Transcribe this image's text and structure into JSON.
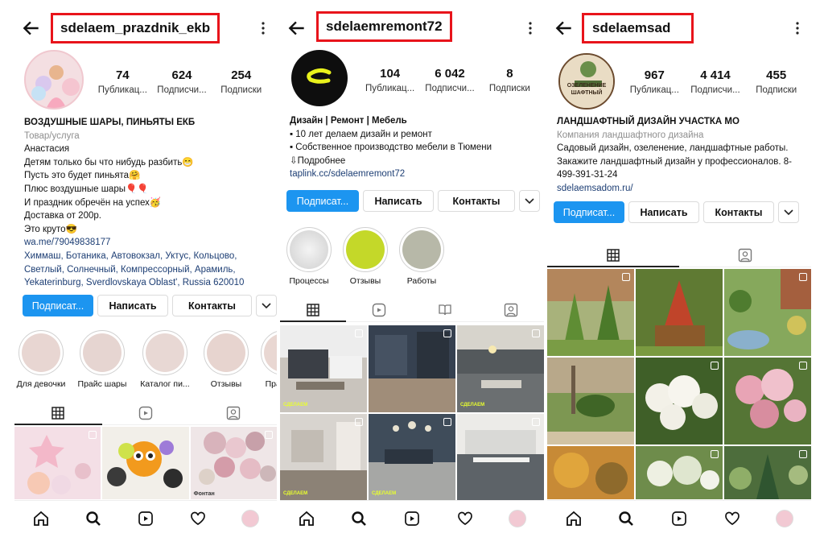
{
  "profiles": [
    {
      "username": "sdelaem_prazdnik_ekb",
      "stats": [
        {
          "num": "74",
          "label": "Публикац..."
        },
        {
          "num": "624",
          "label": "Подписчи..."
        },
        {
          "num": "254",
          "label": "Подписки"
        }
      ],
      "bio": {
        "name": "ВОЗДУШНЫЕ ШАРЫ, ПИНЬЯТЫ ЕКБ",
        "category": "Товар/услуга",
        "lines": [
          "Анастасия",
          "Детям только бы что нибудь разбить😁",
          "Пусть это будет пиньята🤗",
          "Плюс воздушные шары🎈🎈",
          "И праздник обречён на успех🥳",
          "Доставка от 200р.",
          "Это круто😎"
        ],
        "link": "wa.me/79049838177",
        "address": "Химмаш, Ботаника, Автовокзал, Уктус, Кольцово, Светлый, Солнечный, Компрессорный, Арамиль, Yekaterinburg, Sverdlovskaya Oblast', Russia 620010"
      },
      "buttons": {
        "follow": "Подписат...",
        "message": "Написать",
        "contacts": "Контакты"
      },
      "highlights": [
        "Для девочки",
        "Прайс шары",
        "Каталог пи...",
        "Отзывы",
        "Прайс пи"
      ],
      "grid_caption": "Фонтан"
    },
    {
      "username": "sdelaemremont72",
      "stats": [
        {
          "num": "104",
          "label": "Публикац..."
        },
        {
          "num": "6 042",
          "label": "Подписчи..."
        },
        {
          "num": "8",
          "label": "Подписки"
        }
      ],
      "bio": {
        "name": "Дизайн | Ремонт | Мебель",
        "lines": [
          "▪ 10 лет делаем дизайн и ремонт",
          "▪ Собственное производство мебели в Тюмени",
          "⇩Подробнее"
        ],
        "link": "taplink.cc/sdelaemremont72"
      },
      "buttons": {
        "follow": "Подписат...",
        "message": "Написать",
        "contacts": "Контакты"
      },
      "highlights": [
        "Процессы",
        "Отзывы",
        "Работы"
      ],
      "watermark": "СДЕЛАЕМ"
    },
    {
      "username": "sdelaemsad",
      "avatar_text": "ОЗЕЛЕНЕНИЕ ШАФТНЫЙ",
      "stats": [
        {
          "num": "967",
          "label": "Публикац..."
        },
        {
          "num": "4 414",
          "label": "Подписчи..."
        },
        {
          "num": "455",
          "label": "Подписки"
        }
      ],
      "bio": {
        "name": "ЛАНДШАФТНЫЙ ДИЗАЙН УЧАСТКА  МО",
        "category": "Компания ландшафтного дизайна",
        "lines": [
          "Садовый дизайн, озеленение, ландшафтные работы. Закажите ландшафтный дизайн у профессионалов. 8-499-391-31-24"
        ],
        "link": "sdelaemsadom.ru/"
      },
      "buttons": {
        "follow": "Подписат...",
        "message": "Написать",
        "contacts": "Контакты"
      }
    }
  ],
  "colors": {
    "highlight_box": "#e8141b",
    "follow_button": "#1c95f0",
    "link": "#1d3e74"
  }
}
